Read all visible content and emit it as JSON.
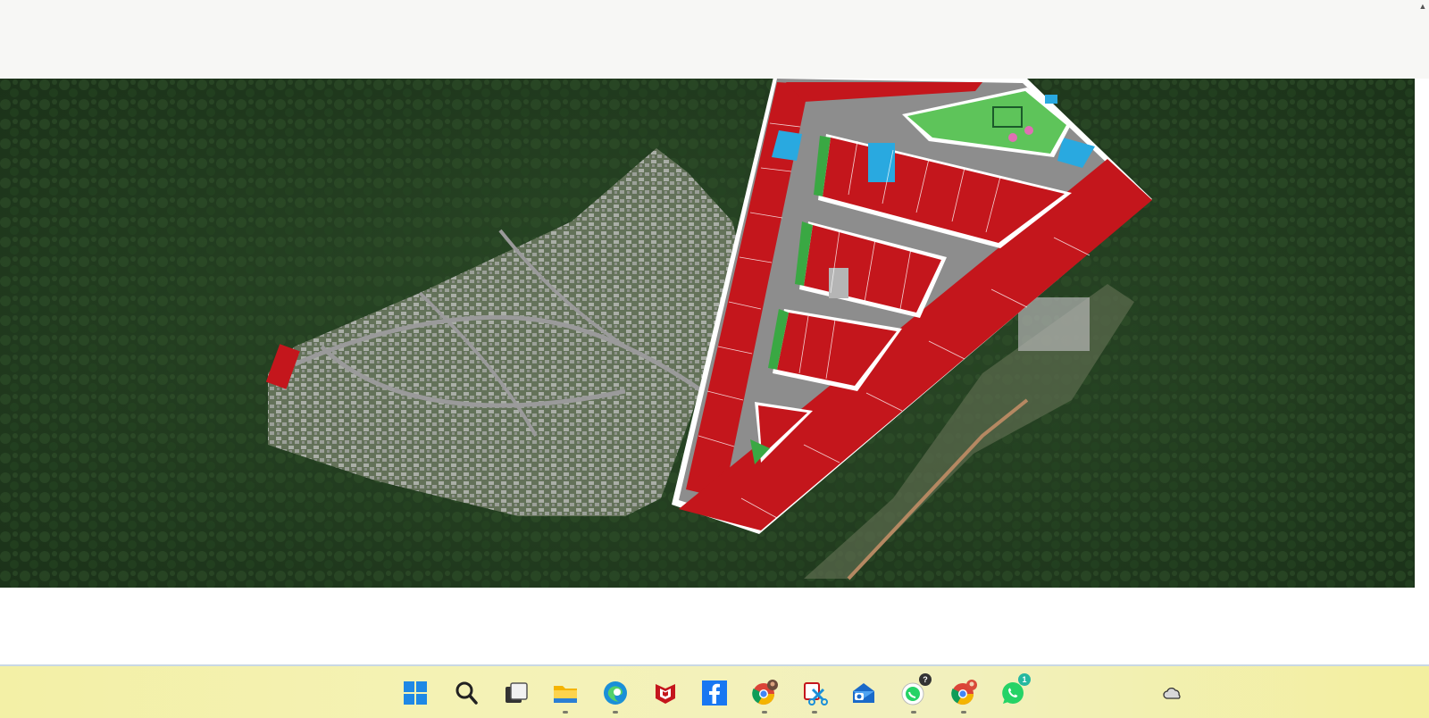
{
  "taskbar": {
    "apps": [
      {
        "name": "windows-start-icon"
      },
      {
        "name": "search-icon"
      },
      {
        "name": "task-view-icon"
      },
      {
        "name": "file-explorer-icon"
      },
      {
        "name": "edge-browser-icon"
      },
      {
        "name": "mcafee-icon"
      },
      {
        "name": "facebook-icon"
      },
      {
        "name": "chrome-profile-icon"
      },
      {
        "name": "snipping-tool-icon"
      },
      {
        "name": "mail-icon"
      },
      {
        "name": "whatsapp-beta-icon",
        "badge": "?"
      },
      {
        "name": "chrome-icon"
      },
      {
        "name": "whatsapp-icon",
        "badge": "1"
      }
    ],
    "tray": {
      "name": "onedrive-cloud-icon"
    }
  },
  "colors": {
    "lot_red": "#c4161c",
    "lot_blue": "#29a9e0",
    "green_space": "#3aa843",
    "forest": "#213a1f",
    "road": "#8d8d8d"
  }
}
